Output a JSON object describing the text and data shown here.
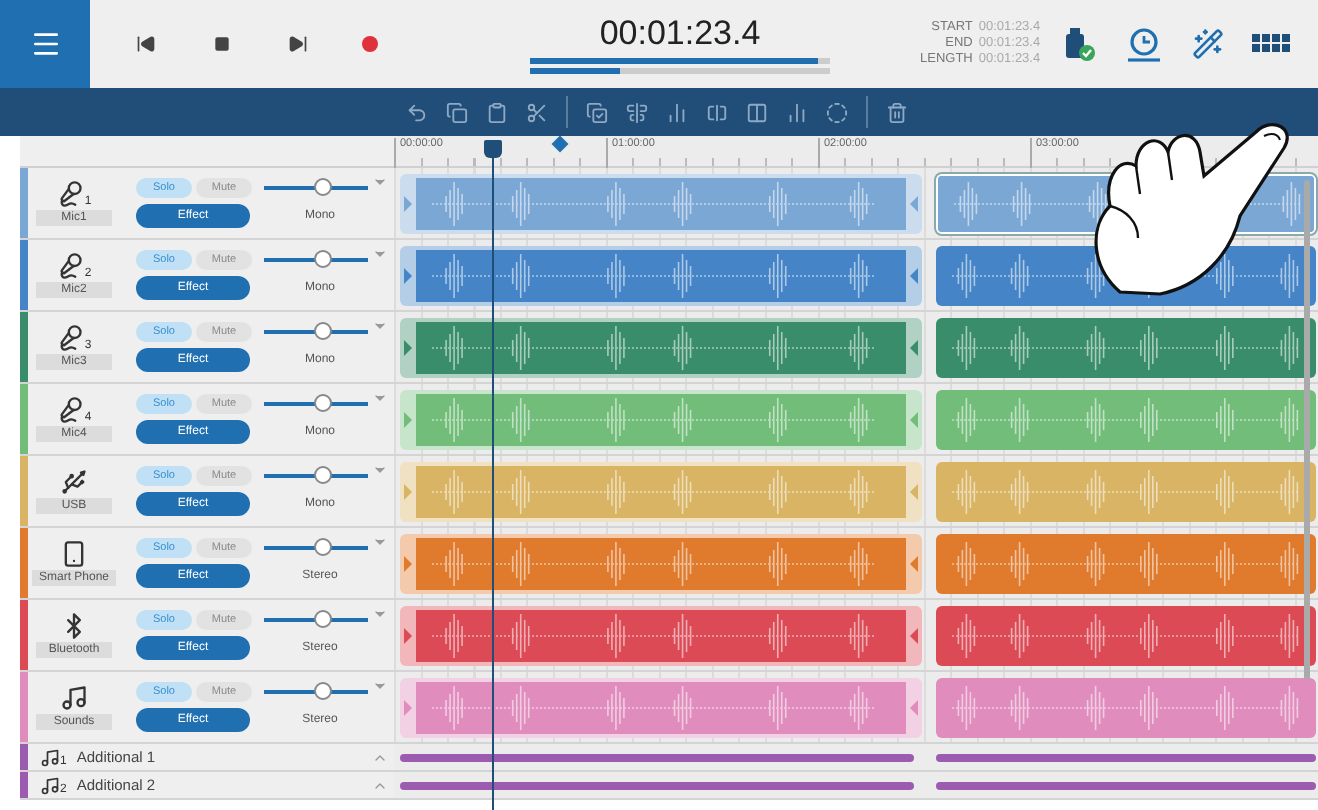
{
  "time": {
    "display": "00:01:23.4",
    "bars": [
      {
        "level": 0.96
      },
      {
        "level": 0.3
      }
    ]
  },
  "range": [
    {
      "label": "START",
      "value": "00:01:23.4"
    },
    {
      "label": "END",
      "value": "00:01:23.4"
    },
    {
      "label": "LENGTH",
      "value": "00:01:23.4"
    }
  ],
  "ruler": [
    "00:00:00",
    "01:00:00",
    "02:00:00",
    "03:00:00"
  ],
  "tracks": [
    {
      "kind": "mic",
      "number": "1",
      "name": "Mic1",
      "color": "#7ba7d4",
      "solo": {
        "label": "Solo",
        "on": false
      },
      "mute": {
        "label": "Mute",
        "on": false
      },
      "effect": {
        "label": "Effect",
        "on": true
      },
      "level": 0.55,
      "mode": "Mono",
      "clips": [
        {
          "handles": true,
          "selected": false
        },
        {
          "handles": false,
          "selected": true
        }
      ]
    },
    {
      "kind": "mic",
      "number": "2",
      "name": "Mic2",
      "color": "#4584c6",
      "solo": {
        "label": "Solo",
        "on": false
      },
      "mute": {
        "label": "Mute",
        "on": false
      },
      "effect": {
        "label": "Effect",
        "on": true
      },
      "level": 0.55,
      "mode": "Mono",
      "clips": [
        {
          "handles": true,
          "selected": false
        },
        {
          "handles": false,
          "selected": false
        }
      ]
    },
    {
      "kind": "mic",
      "number": "3",
      "name": "Mic3",
      "color": "#3a8d6a",
      "solo": {
        "label": "Solo",
        "on": false
      },
      "mute": {
        "label": "Mute",
        "on": false
      },
      "effect": {
        "label": "Effect",
        "on": true
      },
      "level": 0.55,
      "mode": "Mono",
      "clips": [
        {
          "handles": true,
          "selected": false
        },
        {
          "handles": false,
          "selected": false
        }
      ]
    },
    {
      "kind": "mic",
      "number": "4",
      "name": "Mic4",
      "color": "#72bd7a",
      "solo": {
        "label": "Solo",
        "on": false
      },
      "mute": {
        "label": "Mute",
        "on": false
      },
      "effect": {
        "label": "Effect",
        "on": true
      },
      "level": 0.55,
      "mode": "Mono",
      "clips": [
        {
          "handles": true,
          "selected": false
        },
        {
          "handles": false,
          "selected": false
        }
      ]
    },
    {
      "kind": "usb",
      "name": "USB",
      "color": "#d8b464",
      "solo": {
        "label": "Solo",
        "on": false
      },
      "mute": {
        "label": "Mute",
        "on": false
      },
      "effect": {
        "label": "Effect",
        "on": true
      },
      "level": 0.55,
      "mode": "Mono",
      "clips": [
        {
          "handles": true,
          "selected": false
        },
        {
          "handles": false,
          "selected": false
        }
      ]
    },
    {
      "kind": "phone",
      "name": "Smart Phone",
      "color": "#e07a2c",
      "solo": {
        "label": "Solo",
        "on": false
      },
      "mute": {
        "label": "Mute",
        "on": false
      },
      "effect": {
        "label": "Effect",
        "on": true
      },
      "level": 0.55,
      "mode": "Stereo",
      "clips": [
        {
          "handles": true,
          "selected": false
        },
        {
          "handles": false,
          "selected": false
        }
      ]
    },
    {
      "kind": "bluetooth",
      "name": "Bluetooth",
      "color": "#dc4a55",
      "solo": {
        "label": "Solo",
        "on": false
      },
      "mute": {
        "label": "Mute",
        "on": false
      },
      "effect": {
        "label": "Effect",
        "on": true
      },
      "level": 0.55,
      "mode": "Stereo",
      "clips": [
        {
          "handles": true,
          "selected": false
        },
        {
          "handles": false,
          "selected": false
        }
      ]
    },
    {
      "kind": "music",
      "name": "Sounds",
      "color": "#e08dbd",
      "solo": {
        "label": "Solo",
        "on": false
      },
      "mute": {
        "label": "Mute",
        "on": false
      },
      "effect": {
        "label": "Effect",
        "on": true
      },
      "level": 0.55,
      "mode": "Stereo",
      "clips": [
        {
          "handles": true,
          "selected": false
        },
        {
          "handles": false,
          "selected": false
        }
      ]
    }
  ],
  "additional": [
    {
      "number": "1",
      "name": "Additional 1",
      "color": "#9b5cb0"
    },
    {
      "number": "2",
      "name": "Additional 2",
      "color": "#9b5cb0"
    }
  ]
}
